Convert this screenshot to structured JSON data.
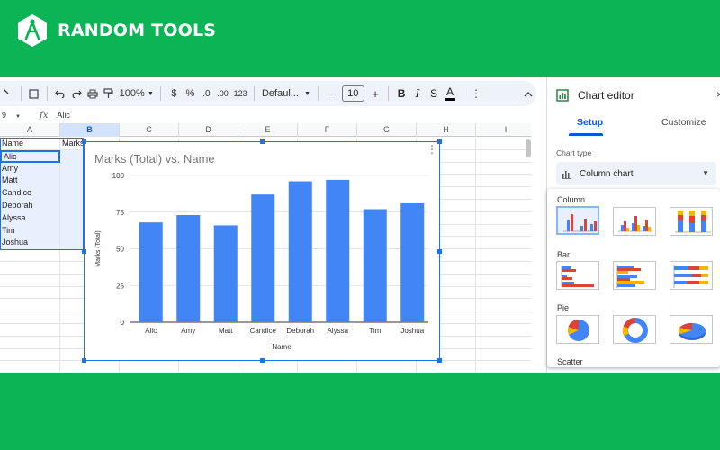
{
  "brand": {
    "name": "RANDOM TOOLS",
    "logo_icon": "compass-hexagon-icon",
    "color": "#0bb556"
  },
  "toolbar": {
    "zoom": "100%",
    "currency": "$",
    "percent": "%",
    "dec_decrease": ".0",
    "dec_increase": ".00",
    "number_format": "123",
    "font": "Defaul...",
    "font_size": "10",
    "minus": "−",
    "plus": "+",
    "bold": "B",
    "italic": "I",
    "strike": "S",
    "text_color": "A"
  },
  "formula_bar": {
    "cell_ref": "9",
    "fx": "fx",
    "value": "Alic"
  },
  "grid": {
    "columns": [
      "A",
      "B",
      "C",
      "D",
      "E",
      "F",
      "G",
      "H",
      "I"
    ],
    "rows": [
      [
        "Name",
        "Marks"
      ],
      [
        "Alic",
        ""
      ],
      [
        "Amy",
        ""
      ],
      [
        "Matt",
        ""
      ],
      [
        "Candice",
        ""
      ],
      [
        "Deborah",
        ""
      ],
      [
        "Alyssa",
        ""
      ],
      [
        "Tim",
        ""
      ],
      [
        "Joshua",
        ""
      ],
      [
        "",
        ""
      ],
      [
        "",
        ""
      ],
      [
        "",
        ""
      ],
      [
        "",
        ""
      ],
      [
        "",
        ""
      ],
      [
        "",
        ""
      ],
      [
        "",
        ""
      ],
      [
        "",
        ""
      ],
      [
        "",
        ""
      ],
      [
        "",
        ""
      ]
    ]
  },
  "chart_data": {
    "type": "bar",
    "title": "Marks (Total) vs. Name",
    "xlabel": "Name",
    "ylabel": "Marks (Total)",
    "categories": [
      "Alic",
      "Amy",
      "Matt",
      "Candice",
      "Deborah",
      "Alyssa",
      "Tim",
      "Joshua"
    ],
    "values": [
      68,
      73,
      66,
      87,
      96,
      97,
      77,
      81
    ],
    "ylim": [
      0,
      100
    ],
    "yticks": [
      0,
      25,
      50,
      75,
      100
    ],
    "grid": true,
    "color": "#4285f4"
  },
  "editor": {
    "title": "Chart editor",
    "close": "×",
    "tabs": [
      "Setup",
      "Customize"
    ],
    "chart_type_label": "Chart type",
    "chart_type_value": "Column chart",
    "sections": [
      "Column",
      "Bar",
      "Pie",
      "Scatter"
    ]
  }
}
